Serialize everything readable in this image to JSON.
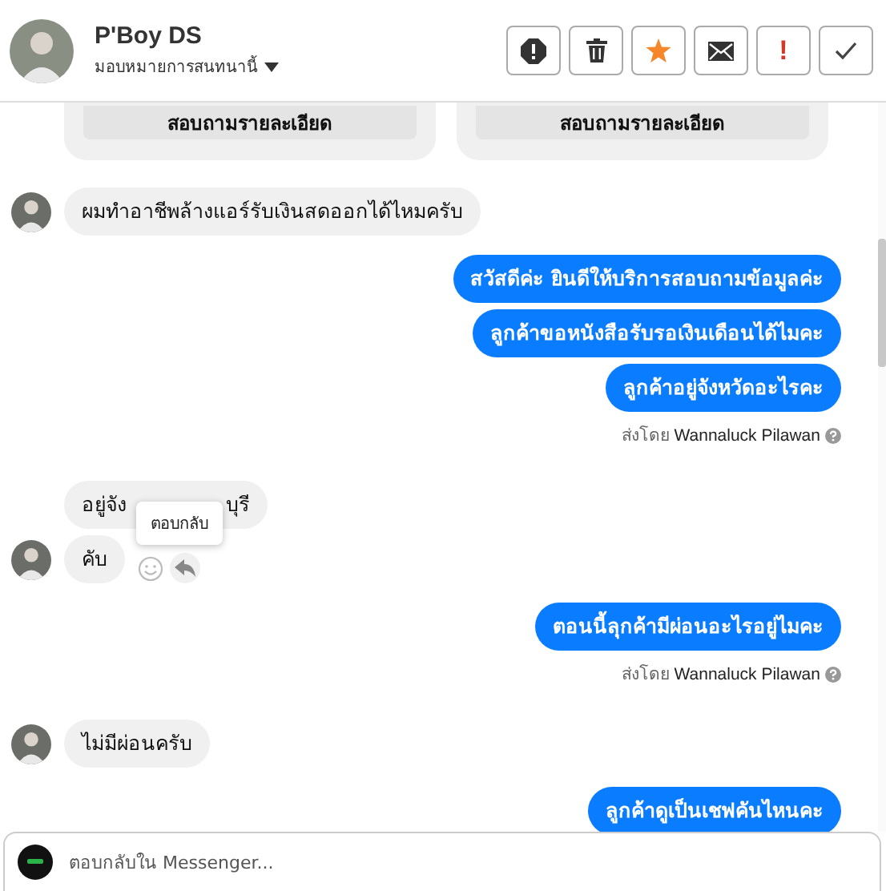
{
  "header": {
    "name": "P'Boy DS",
    "subtitle": "มอบหมายการสนทนานี้",
    "actions": [
      {
        "kind": "block"
      },
      {
        "kind": "delete"
      },
      {
        "kind": "star"
      },
      {
        "kind": "mail"
      },
      {
        "kind": "important",
        "label": "!"
      },
      {
        "kind": "done"
      }
    ]
  },
  "cards": [
    {
      "button": "สอบถามรายละเอียด"
    },
    {
      "button": "สอบถามรายละเอียด"
    }
  ],
  "messages": [
    {
      "kind": "incoming",
      "text": "ผมทำอาชีพล้างแอร์รับเงินสดออกได้ไหมครับ",
      "avatar": true
    },
    {
      "kind": "outgoing",
      "text": "สวัสดีค่ะ  ยินดีให้บริการสอบถามข้อมูลค่ะ"
    },
    {
      "kind": "outgoing",
      "text": "ลูกค้าขอหนังสือรับรอเงินเดือนได้ไมคะ"
    },
    {
      "kind": "outgoing",
      "text": "ลูกค้าอยู่จังหวัดอะไรคะ",
      "sent_by": {
        "prefix": "ส่งโดย",
        "name": "Wannaluck Pilawan"
      }
    },
    {
      "kind": "incoming",
      "text_parts": [
        "อยู่จัง",
        "บุรี"
      ],
      "avatar": false
    },
    {
      "kind": "incoming",
      "text": "คับ",
      "avatar": true,
      "tooltip": "ตอบกลับ"
    },
    {
      "kind": "outgoing",
      "text": "ตอนนี้ลุกค้ามีผ่อนอะไรอยู่ไมคะ",
      "sent_by": {
        "prefix": "ส่งโดย",
        "name": "Wannaluck Pilawan"
      }
    },
    {
      "kind": "incoming",
      "text": "ไม่มีผ่อนครับ",
      "avatar": true
    },
    {
      "kind": "outgoing",
      "text": "ลูกค้าดูเป็นเชฟคันไหนคะ"
    }
  ],
  "composer": {
    "placeholder": "ตอบกลับใน Messenger..."
  }
}
